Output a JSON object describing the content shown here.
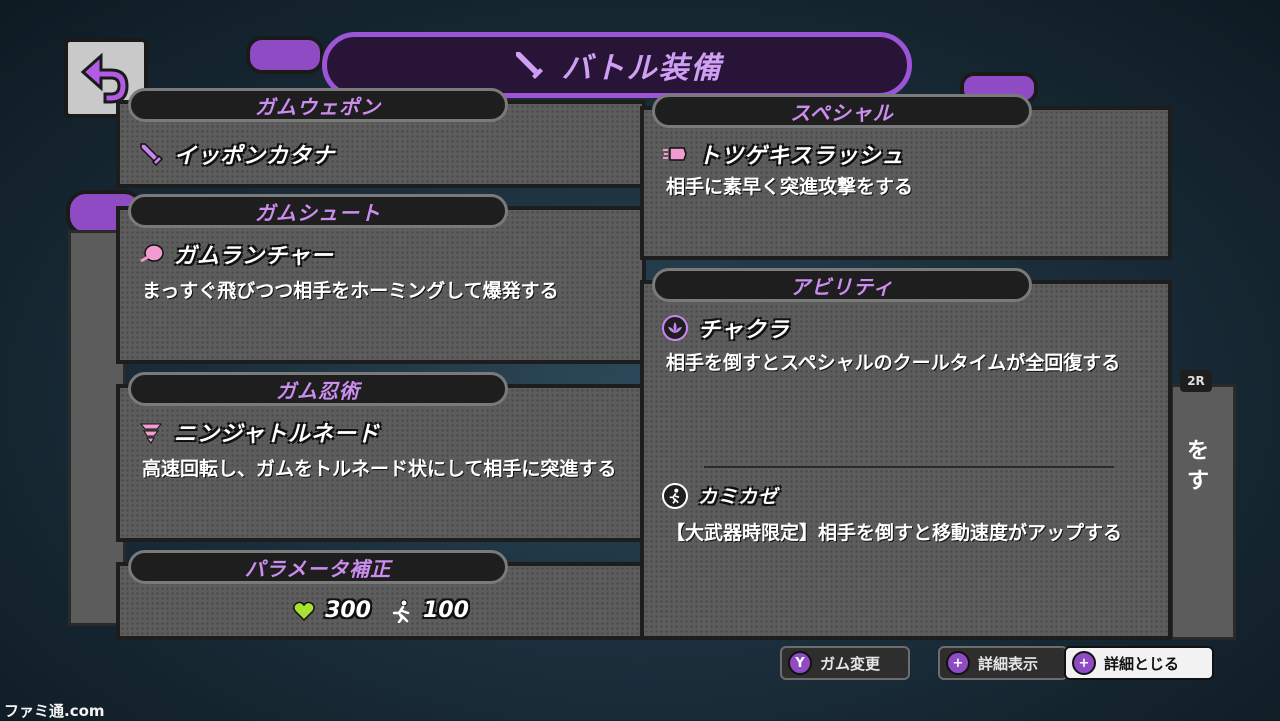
{
  "header": {
    "title": "バトル装備"
  },
  "panels": {
    "gum_weapon": {
      "header": "ガムウェポン",
      "name": "イッポンカタナ"
    },
    "gum_shoot": {
      "header": "ガムシュート",
      "name": "ガムランチャー",
      "desc": "まっすぐ飛びつつ相手をホーミングして爆発する"
    },
    "gum_ninjutsu": {
      "header": "ガム忍術",
      "name": "ニンジャトルネード",
      "desc": "高速回転し、ガムをトルネード状にして相手に突進する"
    },
    "params": {
      "header": "パラメータ補正",
      "hp": "300",
      "speed": "100"
    },
    "special": {
      "header": "スペシャル",
      "name": "トツゲキスラッシュ",
      "desc": "相手に素早く突進攻撃をする"
    },
    "ability": {
      "header": "アビリティ",
      "items": [
        {
          "name": "チャクラ",
          "desc": "相手を倒すとスペシャルのクールタイムが全回復する"
        },
        {
          "name": "カミカゼ",
          "desc": "【大武器時限定】相手を倒すと移動速度がアップする"
        }
      ]
    }
  },
  "background": {
    "partial_text": "をす",
    "badge": "2R"
  },
  "controls": [
    {
      "button": "Y",
      "label": "ガム変更"
    },
    {
      "button": "+",
      "label": "詳細表示"
    },
    {
      "button": "+",
      "label": "詳細とじる"
    }
  ],
  "watermark": "ファミ通.com",
  "colors": {
    "accent": "#9c55d6",
    "panel": "#5d5d5d",
    "header_text": "#cc8df0",
    "hp": "#a6e22e"
  }
}
